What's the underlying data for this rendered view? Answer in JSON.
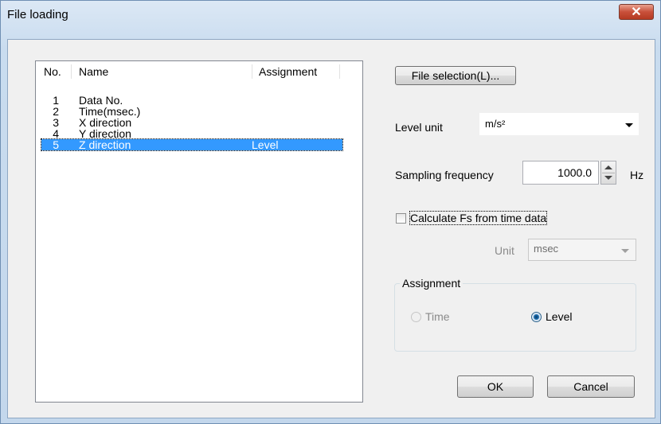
{
  "window": {
    "title": "File loading",
    "close_label": "✕"
  },
  "list": {
    "columns": [
      "No.",
      "Name",
      "Assignment"
    ],
    "rows": [
      {
        "no": "1",
        "name": "Data No.",
        "assignment": ""
      },
      {
        "no": "2",
        "name": "Time(msec.)",
        "assignment": ""
      },
      {
        "no": "3",
        "name": "X direction",
        "assignment": ""
      },
      {
        "no": "4",
        "name": "Y direction",
        "assignment": ""
      },
      {
        "no": "5",
        "name": "Z direction",
        "assignment": "Level",
        "selected": true
      }
    ]
  },
  "file_selection": {
    "label": "File selection(L)..."
  },
  "level_unit": {
    "label": "Level unit",
    "value": "m/s²"
  },
  "sampling": {
    "label": "Sampling frequency",
    "value": "1000.0",
    "unit": "Hz"
  },
  "calc_fs": {
    "label": "Calculate Fs from time data",
    "checked": false
  },
  "unit": {
    "label": "Unit",
    "value": "msec"
  },
  "assignment": {
    "title": "Assignment",
    "time_label": "Time",
    "level_label": "Level",
    "selected": "Level"
  },
  "buttons": {
    "ok": "OK",
    "cancel": "Cancel"
  },
  "colors": {
    "selection": "#3399ff",
    "close": "#c8503a"
  }
}
